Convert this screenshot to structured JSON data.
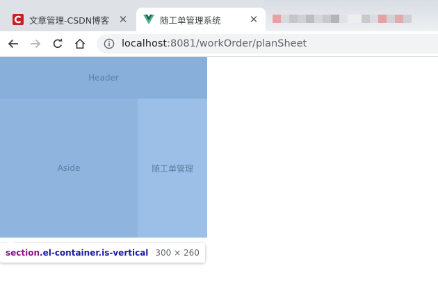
{
  "tabs": [
    {
      "title": "文章管理-CSDN博客",
      "favicon": "csdn-icon",
      "close": "✕",
      "active": false
    },
    {
      "title": "随工单管理系统",
      "favicon": "vue-icon",
      "close": "✕",
      "active": true
    }
  ],
  "address_bar": {
    "host": "localhost",
    "rest": ":8081/workOrder/planSheet"
  },
  "layout": {
    "header_label": "Header",
    "aside_label": "Aside",
    "main_label": "随工单管理"
  },
  "inspect_tooltip": {
    "tag": "section",
    "classes": ".el-container.is-vertical",
    "size": "300 × 260"
  },
  "colors": {
    "header": "#87afd9",
    "aside": "#8fb4de",
    "main": "#9bbfe6",
    "csdn_red": "#c91f25",
    "vue_green": "#41b883",
    "vue_dark": "#35495e"
  }
}
